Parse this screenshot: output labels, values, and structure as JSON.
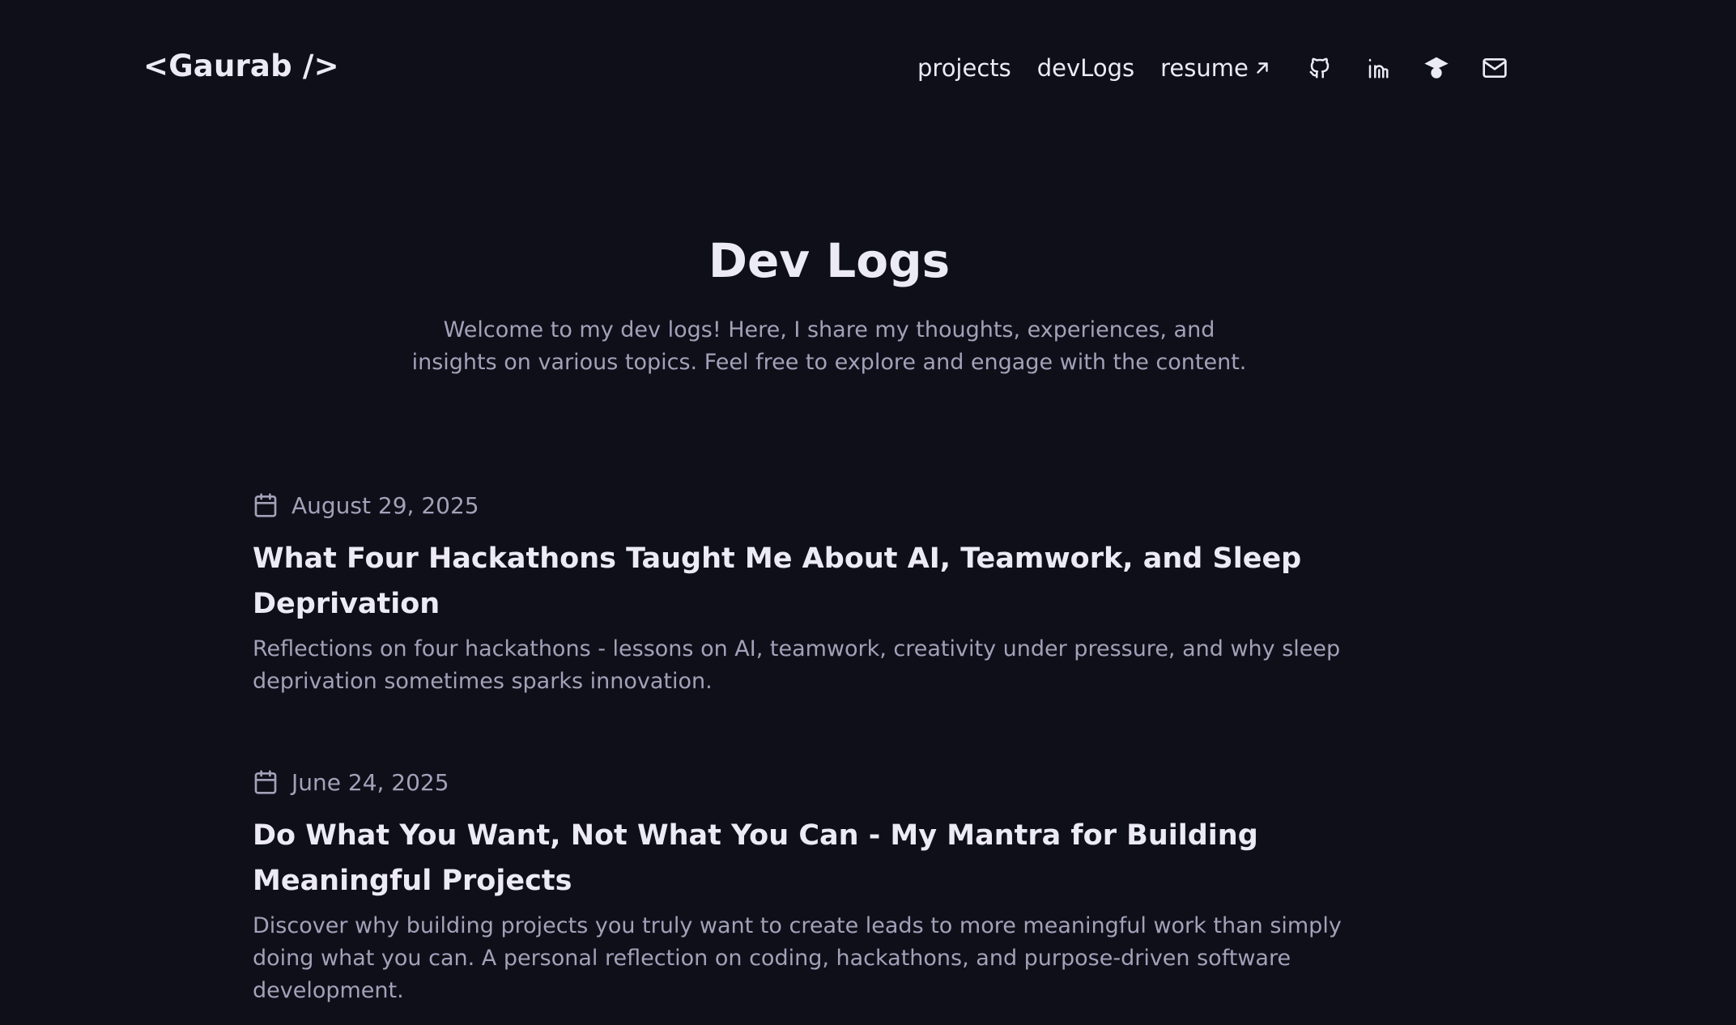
{
  "header": {
    "logo": "<Gaurab />",
    "nav": [
      {
        "label": "projects"
      },
      {
        "label": "devLogs"
      },
      {
        "label": "resume"
      }
    ],
    "icons": [
      "github-icon",
      "linkedin-icon",
      "graduation-cap-icon",
      "mail-icon"
    ]
  },
  "hero": {
    "title": "Dev Logs",
    "subtitle": "Welcome to my dev logs! Here, I share my thoughts, experiences, and insights on various topics. Feel free to explore and engage with the content."
  },
  "posts": [
    {
      "date": "August 29, 2025",
      "title": "What Four Hackathons Taught Me About AI, Teamwork, and Sleep Deprivation",
      "description": "Reflections on four hackathons - lessons on AI, teamwork, creativity under pressure, and why sleep deprivation sometimes sparks innovation."
    },
    {
      "date": "June 24, 2025",
      "title": "Do What You Want, Not What You Can - My Mantra for Building Meaningful Projects",
      "description": "Discover why building projects you truly want to create leads to more meaningful work than simply doing what you can. A personal reflection on coding, hackathons, and purpose-driven software development."
    }
  ],
  "colors": {
    "background": "#0f0f1a",
    "text": "#ecebf5",
    "muted": "#a3a1b8"
  }
}
